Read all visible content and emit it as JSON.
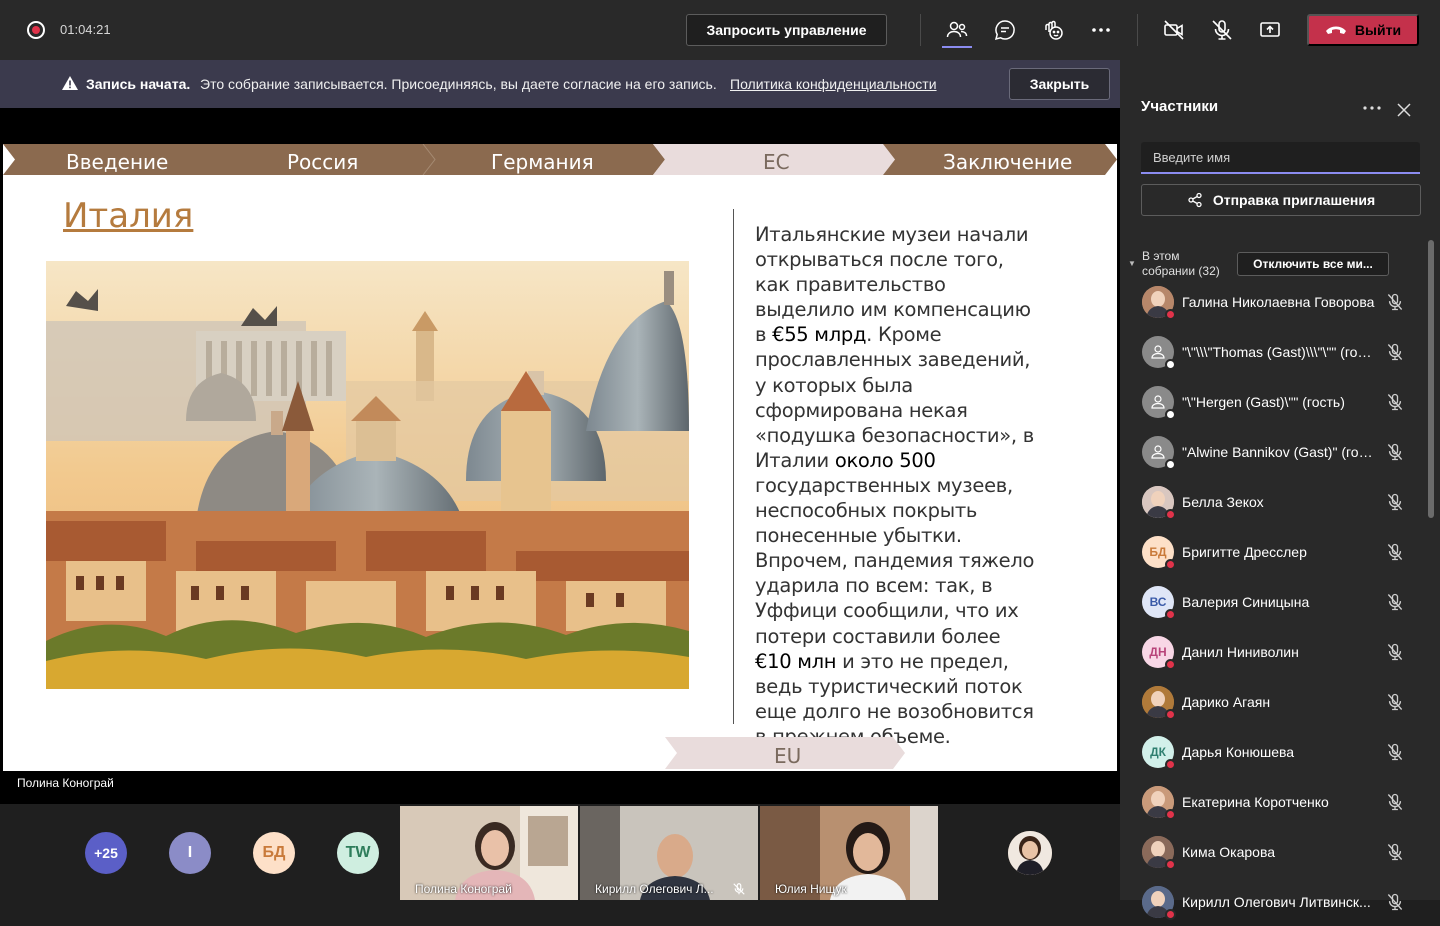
{
  "topbar": {
    "timer": "01:04:21",
    "request_control": "Запросить управление",
    "leave_label": "Выйти"
  },
  "banner": {
    "title": "Запись начата.",
    "text": "Это собрание записывается. Присоединяясь, вы даете согласие на его запись.",
    "link": "Политика конфиденциальности",
    "close": "Закрыть"
  },
  "slide": {
    "nav": [
      "Введение",
      "Россия",
      "Германия",
      "ЕС",
      "Заключение"
    ],
    "active_nav": "ЕС",
    "title": "Италия",
    "text_parts": [
      "Итальянские музеи начали открываться после того, как правительство выделило им компенсацию в ",
      "€55 млрд",
      ". Кроме прославленных заведений, у которых была сформирована некая «подушка безопасности», в Италии ",
      "около 500",
      " государственных музеев, неспособных покрыть понесенные убытки. Впрочем, пандемия тяжело ударила по всем: так, в Уффици сообщили, что их потери составили более ",
      "€10 млн",
      " и это не предел, ведь туристический поток еще долго не возобновится в прежнем объеме."
    ],
    "footer_tag": "EU",
    "presenter": "Полина Конограй"
  },
  "bottom": {
    "avatars": [
      {
        "label": "+25",
        "bg": "#5b5fc7",
        "fg": "#ffffff"
      },
      {
        "label": "I",
        "bg": "#8b8cc7",
        "fg": "#ffffff"
      },
      {
        "label": "БД",
        "bg": "#fde0c8",
        "fg": "#c97a3a"
      },
      {
        "label": "TW",
        "bg": "#cfeee0",
        "fg": "#2e7d5b"
      }
    ],
    "videos": [
      {
        "name": "Полина Конограй"
      },
      {
        "name": "Кирилл Олегович Л..."
      },
      {
        "name": "Юлия Нищук"
      }
    ]
  },
  "panel": {
    "title": "Участники",
    "search_placeholder": "Введите имя",
    "invite": "Отправка приглашения",
    "in_meeting_line1": "В этом",
    "in_meeting_line2": "собрании (32)",
    "mute_all": "Отключить все ми...",
    "participants": [
      {
        "name": "Галина Николаевна Говорова",
        "avatar": "photo",
        "bg": "#b7876a",
        "initials": ""
      },
      {
        "name": "\"\\\"\\\\\\\"Thomas (Gast)\\\\\\\"\\\"\" (гость)",
        "avatar": "guest",
        "bg": "#8a8a8a",
        "initials": ""
      },
      {
        "name": "\"\\\"Hergen (Gast)\\\"\" (гость)",
        "avatar": "guest",
        "bg": "#8a8a8a",
        "initials": ""
      },
      {
        "name": "\"Alwine Bannikov (Gast)\" (гость)",
        "avatar": "guest",
        "bg": "#8a8a8a",
        "initials": ""
      },
      {
        "name": "Белла Зекох",
        "avatar": "photo",
        "bg": "#d9c7c0",
        "initials": ""
      },
      {
        "name": "Бригитте Дресслер",
        "avatar": "initials",
        "bg": "#fde0c8",
        "fg": "#c97a3a",
        "initials": "БД"
      },
      {
        "name": "Валерия Синицына",
        "avatar": "initials",
        "bg": "#dfe6f7",
        "fg": "#3a5aa8",
        "initials": "ВС"
      },
      {
        "name": "Данил Ниниволин",
        "avatar": "initials",
        "bg": "#f8d7e6",
        "fg": "#b8447a",
        "initials": "ДН"
      },
      {
        "name": "Дарико Агаян",
        "avatar": "photo",
        "bg": "#b07a3a",
        "initials": ""
      },
      {
        "name": "Дарья Конюшева",
        "avatar": "initials",
        "bg": "#d2f0ea",
        "fg": "#2f7f70",
        "initials": "ДК"
      },
      {
        "name": "Екатерина Коротченко",
        "avatar": "photo",
        "bg": "#c99a7a",
        "initials": ""
      },
      {
        "name": "Кима Окарова",
        "avatar": "photo",
        "bg": "#8a6a5a",
        "initials": ""
      },
      {
        "name": "Кирилл Олегович Литвинск...",
        "avatar": "photo",
        "bg": "#5a6a8a",
        "initials": ""
      }
    ]
  },
  "colors": {
    "accent": "#8b8cf0",
    "leave": "#c4314b",
    "nav_brown": "#8b6a4f",
    "nav_active": "#e9dcdc",
    "title": "#b57b3e"
  }
}
